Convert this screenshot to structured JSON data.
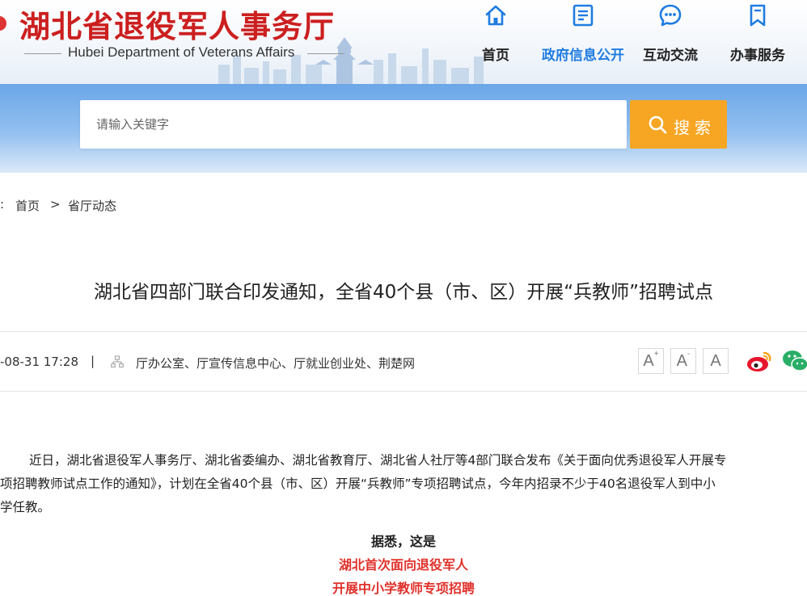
{
  "header": {
    "site_title": "湖北省退役军人事务厅",
    "site_subtitle": "Hubei Department of Veterans Affairs"
  },
  "nav": {
    "items": [
      {
        "label": "首页",
        "icon": "home-icon"
      },
      {
        "label": "政府信息公开",
        "icon": "document-icon",
        "active": true
      },
      {
        "label": "互动交流",
        "icon": "chat-icon"
      },
      {
        "label": "办事服务",
        "icon": "bookmark-icon"
      }
    ]
  },
  "search": {
    "placeholder": "请输入关键字",
    "button_label": "搜索"
  },
  "breadcrumb": {
    "lead": ":",
    "home": "首页",
    "separator": ">",
    "current": "省厅动态"
  },
  "article": {
    "title": "湖北省四部门联合印发通知，全省40个县（市、区）开展“兵教师”招聘试点",
    "date": "-08-31 17:28",
    "separator": "|",
    "source": "厅办公室、厅宣传信息中心、厅就业创业处、荆楚网",
    "font_controls": [
      "A",
      "A",
      "A"
    ],
    "font_marks": [
      "+",
      "-"
    ],
    "body_lines": [
      "近日，湖北省退役军人事务厅、湖北省委编办、湖北省教育厅、湖北省人社厅等4部门联合发布《关于面向优秀退役军人开展专",
      "项招聘教师试点工作的通知》，计划在全省40个县（市、区）开展“兵教师”专项招聘试点，今年内招录不少于40名退役军人到中小",
      "学任教。"
    ],
    "highlight_intro": "据悉，这是",
    "highlight_line1": "湖北首次面向退役军人",
    "highlight_line2": "开展中小学教师专项招聘"
  },
  "colors": {
    "brand_red": "#cc1f1f",
    "nav_active": "#1f7ce0",
    "search_button": "#f6a623",
    "highlight_red": "#e0312b",
    "weibo": "#e6162d",
    "wechat": "#2aae67"
  }
}
